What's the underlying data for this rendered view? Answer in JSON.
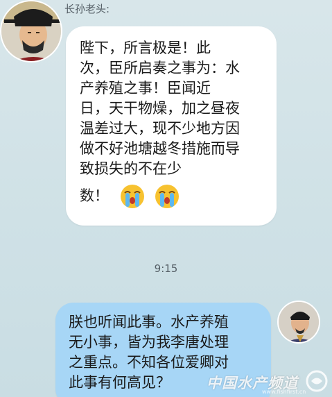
{
  "conversation": {
    "incoming": {
      "sender_name": "长孙老头:",
      "text": "陛下，所言极是！此\n次，臣所启奏之事为：水\n产养殖之事！臣闻近\n日，天干物燥，加之昼夜\n温差过大，现不少地方因\n做不好池塘越冬措施而导\n致损失的不在少",
      "tail_text": "数！",
      "emoji": [
        "crying-face-emoji",
        "crying-face-emoji"
      ]
    },
    "timestamp": "9:15",
    "outgoing": {
      "text": "朕也听闻此事。水产养殖\n无小事，皆为我李唐处理\n之重点。不知各位爱卿对\n此事有何高见？"
    }
  },
  "watermark": {
    "title": "中国水产频道",
    "url": "www.fishfirst.cn"
  },
  "colors": {
    "background": "#cfe1e6",
    "incoming_bubble": "#ffffff",
    "outgoing_bubble": "#a7d6f6",
    "meta_text": "#555f66"
  }
}
